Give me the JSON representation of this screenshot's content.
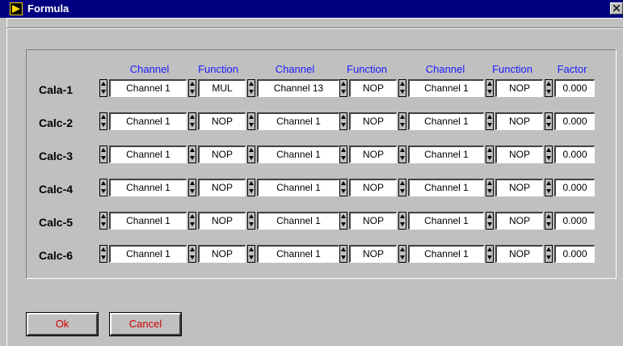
{
  "window": {
    "title": "Formula"
  },
  "headers": [
    "Channel",
    "Function",
    "Channel",
    "Function",
    "Channel",
    "Function",
    "Factor"
  ],
  "rows": [
    {
      "label": "Cala-1",
      "ch1": "Channel 1",
      "fn1": "MUL",
      "ch2": "Channel 13",
      "fn2": "NOP",
      "ch3": "Channel 1",
      "fn3": "NOP",
      "factor": "0.000"
    },
    {
      "label": "Calc-2",
      "ch1": "Channel 1",
      "fn1": "NOP",
      "ch2": "Channel 1",
      "fn2": "NOP",
      "ch3": "Channel 1",
      "fn3": "NOP",
      "factor": "0.000"
    },
    {
      "label": "Calc-3",
      "ch1": "Channel 1",
      "fn1": "NOP",
      "ch2": "Channel 1",
      "fn2": "NOP",
      "ch3": "Channel 1",
      "fn3": "NOP",
      "factor": "0.000"
    },
    {
      "label": "Calc-4",
      "ch1": "Channel 1",
      "fn1": "NOP",
      "ch2": "Channel 1",
      "fn2": "NOP",
      "ch3": "Channel 1",
      "fn3": "NOP",
      "factor": "0.000"
    },
    {
      "label": "Calc-5",
      "ch1": "Channel 1",
      "fn1": "NOP",
      "ch2": "Channel 1",
      "fn2": "NOP",
      "ch3": "Channel 1",
      "fn3": "NOP",
      "factor": "0.000"
    },
    {
      "label": "Calc-6",
      "ch1": "Channel 1",
      "fn1": "NOP",
      "ch2": "Channel 1",
      "fn2": "NOP",
      "ch3": "Channel 1",
      "fn3": "NOP",
      "factor": "0.000"
    }
  ],
  "buttons": {
    "ok": "Ok",
    "cancel": "Cancel"
  },
  "colors": {
    "titlebar": "#000080",
    "header_text": "#1a1aff",
    "button_text": "#d00000",
    "face": "#c0c0c0"
  }
}
